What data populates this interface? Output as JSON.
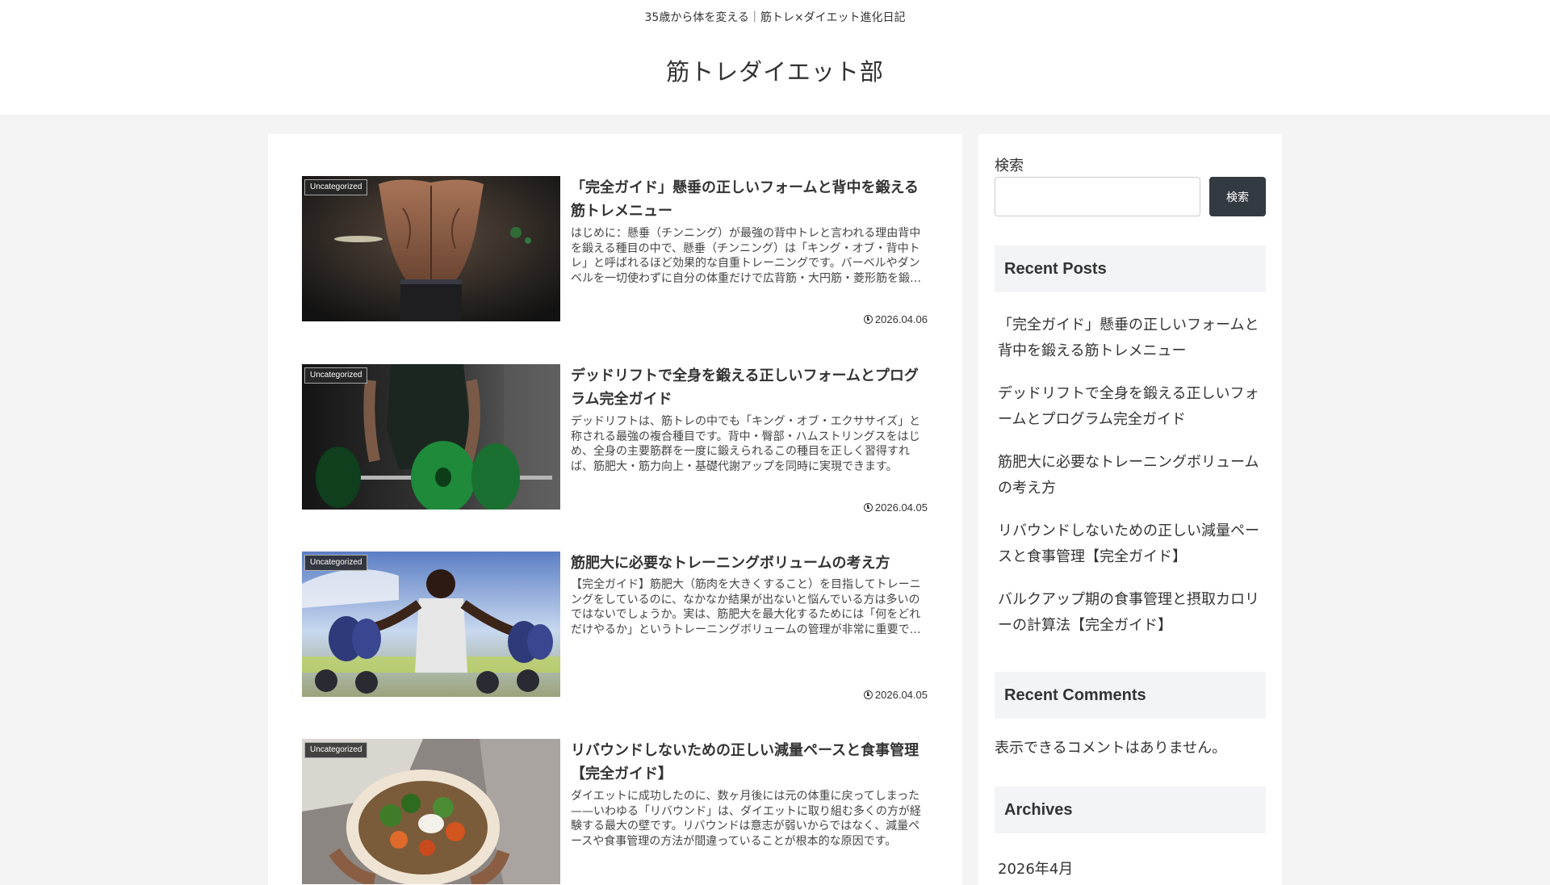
{
  "header": {
    "tagline": "35歳から体を変える｜筋トレ×ダイエット進化日記",
    "site_title": "筋トレダイエット部"
  },
  "posts": [
    {
      "category": "Uncategorized",
      "title": "「完全ガイド」懸垂の正しいフォームと背中を鍛える筋トレメニュー",
      "snippet": "はじめに：懸垂（チンニング）が最強の背中トレと言われる理由背中を鍛える種目の中で、懸垂（チンニング）は「キング・オブ・背中トレ」と呼ばれるほど効果的な自重トレーニングです。バーベルやダンベルを一切使わずに自分の体重だけで広背筋・大円筋・菱形筋を鍛えることができます。",
      "date": "2026.04.06",
      "thumb_icon": "back-muscles-photo"
    },
    {
      "category": "Uncategorized",
      "title": "デッドリフトで全身を鍛える正しいフォームとプログラム完全ガイド",
      "snippet": "デッドリフトは、筋トレの中でも「キング・オブ・エクササイズ」と称される最強の複合種目です。背中・臀部・ハムストリングスをはじめ、全身の主要筋群を一度に鍛えられるこの種目を正しく習得すれば、筋肥大・筋力向上・基礎代謝アップを同時に実現できます。",
      "date": "2026.04.05",
      "thumb_icon": "deadlift-photo"
    },
    {
      "category": "Uncategorized",
      "title": "筋肥大に必要なトレーニングボリュームの考え方",
      "snippet": "【完全ガイド】筋肥大（筋肉を大きくすること）を目指してトレーニングをしているのに、なかなか結果が出ないと悩んでいる方は多いのではないでしょうか。実は、筋肥大を最大化するためには「何をどれだけやるか」というトレーニングボリュームの管理が非常に重要です。",
      "date": "2026.04.05",
      "thumb_icon": "dumbbell-photo"
    },
    {
      "category": "Uncategorized",
      "title": "リバウンドしないための正しい減量ペースと食事管理【完全ガイド】",
      "snippet": "ダイエットに成功したのに、数ヶ月後には元の体重に戻ってしまった——いわゆる「リバウンド」は、ダイエットに取り組む多くの方が経験する最大の壁です。リバウンドは意志が弱いからではなく、減量ペースや食事管理の方法が間違っていることが根本的な原因です。",
      "date": "",
      "thumb_icon": "salad-bowl-photo"
    }
  ],
  "sidebar": {
    "search_label": "検索",
    "search_placeholder": "",
    "search_button": "検索",
    "recent_posts_heading": "Recent Posts",
    "recent_posts": [
      "「完全ガイド」懸垂の正しいフォームと背中を鍛える筋トレメニュー",
      "デッドリフトで全身を鍛える正しいフォームとプログラム完全ガイド",
      "筋肥大に必要なトレーニングボリュームの考え方",
      "リバウンドしないための正しい減量ペースと食事管理【完全ガイド】",
      "バルクアップ期の食事管理と摂取カロリーの計算法【完全ガイド】"
    ],
    "recent_comments_heading": "Recent Comments",
    "no_comments": "表示できるコメントはありません。",
    "archives_heading": "Archives",
    "archives": [
      "2026年4月"
    ]
  },
  "colors": {
    "page_bg": "#f4f4f4",
    "button_bg": "#333a42",
    "widget_heading_bg": "#f3f4f5"
  }
}
